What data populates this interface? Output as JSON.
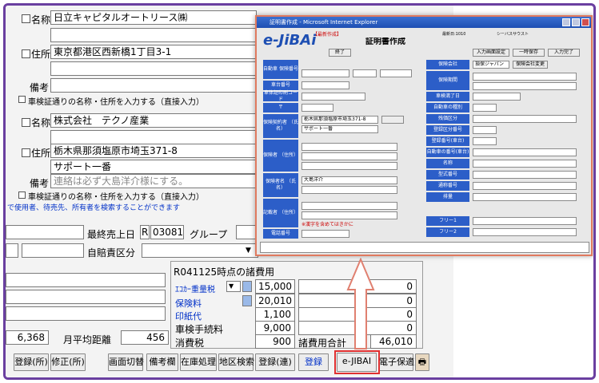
{
  "main": {
    "row1": {
      "name_label": "名称",
      "name_value": "日立キャピタルオートリース㈱"
    },
    "row2": {
      "addr_label": "住所",
      "addr_value": "東京都港区西新橋1丁目3-1"
    },
    "row3": {
      "note_label": "備考",
      "check_text": "車検証通りの名称・住所を入力する（直接入力）"
    },
    "row4": {
      "name_label": "名称",
      "name_value": "株式会社　テクノ産業"
    },
    "row5": {
      "addr_label": "住所",
      "addr_value": "栃木県那須塩原市埼玉371-8",
      "addr_value2": "サポート一番"
    },
    "row6": {
      "note_label": "備考",
      "note_value": "連絡は必ず大島洋介様にする。",
      "check_text": "車検証通りの名称・住所を入力する（直接入力）"
    },
    "search_hint": "で使用者、待売先、所有者を検索することができます",
    "last_sale_label": "最終売上日",
    "last_sale_flag": "R",
    "last_sale_value": "030816",
    "group_label": "グループ",
    "insurance_label": "自賠責区分",
    "fees_title": "R041125時点の諸費用",
    "fees": [
      {
        "label": "ｴｺｶｰ重量税",
        "value": "15,000",
        "right": "0"
      },
      {
        "label": "保険料",
        "value": "20,010",
        "right": "0"
      },
      {
        "label": "印紙代",
        "value": "1,100",
        "right": "0"
      },
      {
        "label": "車検手続料",
        "value": "9,000",
        "right": "0"
      },
      {
        "label": "消費税",
        "value": "900",
        "right": "46,010"
      }
    ],
    "fees_total_label": "諸費用合計",
    "left_number": "6,368",
    "monthly_label": "月平均距離",
    "monthly_value": "456",
    "buttons": [
      "登録(所)",
      "修正(所)",
      "画面切替",
      "備考欄",
      "在庫処理",
      "地区検索",
      "登録(連)",
      "登録",
      "e-JIBAI",
      "電子保適"
    ]
  },
  "overlay": {
    "title": "証明書作成 - Microsoft Internet Explorer",
    "logo": "e-JiBAi",
    "logo_sub": "【最新作成】",
    "heading": "証明書作成",
    "top_buttons": [
      "入力画面設定",
      "一時保存",
      "入力完了"
    ],
    "date_info": "最新日:1010",
    "header_info": "シーバスサウスト",
    "btn_small": "終了",
    "labels_left": [
      "自動車\n保険番号",
      "車台番号",
      "車体証印刷コード",
      "〒",
      "保険契約者\n（氏名）",
      "保険者\n（住所）",
      "保険者名\n（氏名）",
      "記載者\n（住所）",
      "電話番号"
    ],
    "labels_right": [
      "保険会社",
      "保険期間",
      "車検満了日",
      "自動車の種別",
      "残価区分",
      "登録区分番号",
      "登録番号(車台)",
      "自動車の番号(車台)",
      "名称",
      "型式番号",
      "通称番号",
      "排量",
      "フリー1",
      "フリー2"
    ],
    "addr_text": "栃木県那須塩原市埼玉371-8",
    "bldg_text": "サポート一番",
    "person_text": "大島洋介",
    "warn_text": "※漢字を含めてはきかに",
    "sample_company": "損保ジャパン",
    "sample_button": "保険会社変更"
  }
}
